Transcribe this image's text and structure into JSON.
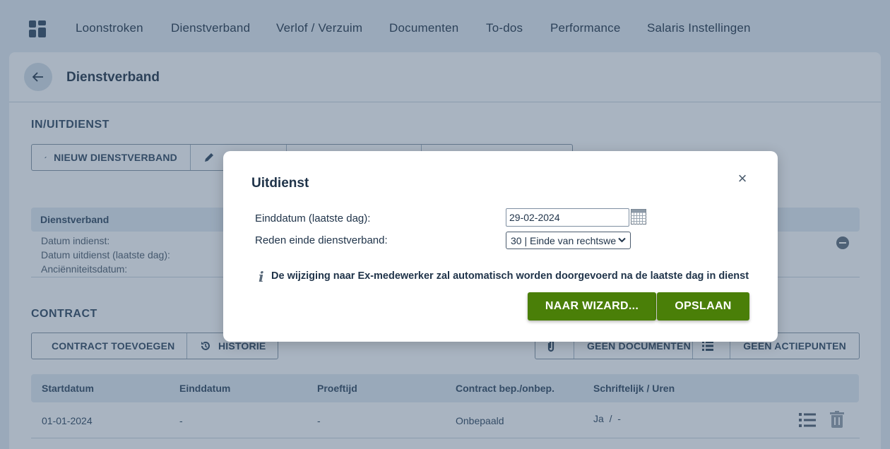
{
  "nav": {
    "items": [
      "Loonstroken",
      "Dienstverband",
      "Verlof / Verzuim",
      "Documenten",
      "To-dos",
      "Performance",
      "Salaris Instellingen"
    ]
  },
  "page": {
    "title": "Dienstverband"
  },
  "inuitdienst": {
    "title": "IN/UITDIENST",
    "new_button": "NIEUW DIENSTVERBAND"
  },
  "dienstverband_info": {
    "header": "Dienstverband",
    "labels": [
      "Datum indienst:",
      "Datum uitdienst (laatste dag):",
      "Anciënniteitsdatum:"
    ]
  },
  "contract": {
    "title": "CONTRACT",
    "add_button": "CONTRACT TOEVOEGEN",
    "history_button": "HISTORIE",
    "documents_button": "GEEN DOCUMENTEN",
    "actions_button": "GEEN ACTIEPUNTEN",
    "columns": [
      "Startdatum",
      "Einddatum",
      "Proeftijd",
      "Contract bep./onbep.",
      "Schriftelijk / Uren"
    ],
    "row": [
      "01-01-2024",
      "-",
      "-",
      "Onbepaald",
      "Ja  /  -"
    ]
  },
  "modal": {
    "title": "Uitdienst",
    "end_date_label": "Einddatum (laatste dag):",
    "end_date_value": "29-02-2024",
    "reason_label": "Reden einde dienstverband:",
    "reason_value": "30 | Einde van rechtswe",
    "notice": "De wijziging naar Ex-medewerker zal automatisch worden doorgevoerd na de laatste dag in dienst",
    "wizard_button": "NAAR WIZARD...",
    "save_button": "OPSLAAN"
  },
  "colors": {
    "primary_green": "#4a7f08",
    "navy_text": "#1f3349"
  }
}
